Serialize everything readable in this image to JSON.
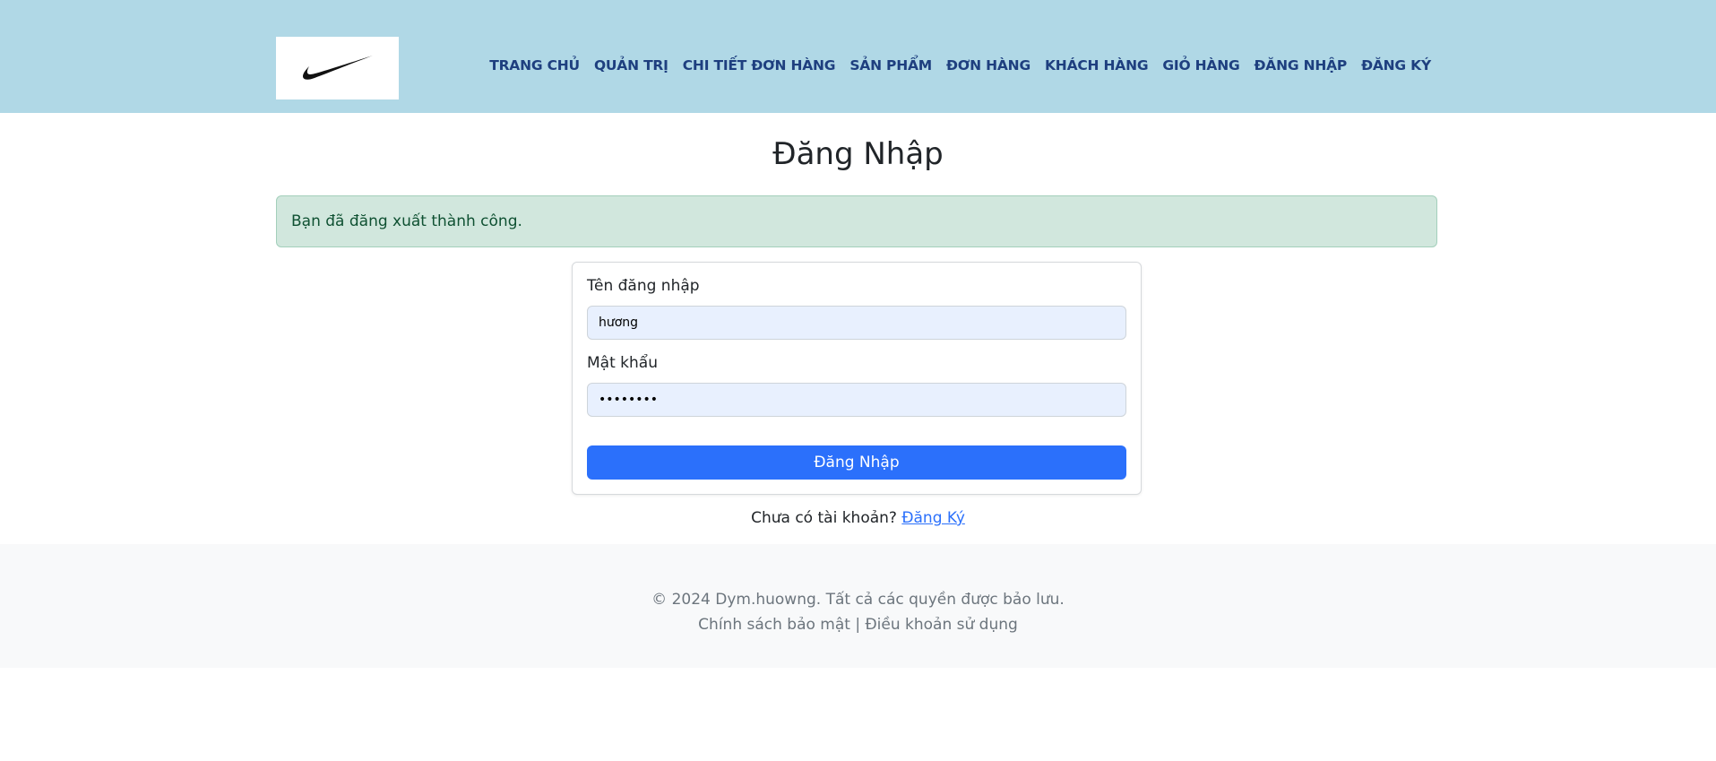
{
  "header": {
    "logo_name": "nike-swoosh-logo",
    "nav": [
      "TRANG CHỦ",
      "QUẢN TRỊ",
      "CHI TIẾT ĐƠN HÀNG",
      "SẢN PHẨM",
      "ĐƠN HÀNG",
      "KHÁCH HÀNG",
      "GIỎ HÀNG",
      "ĐĂNG NHẬP",
      "ĐĂNG KÝ"
    ]
  },
  "main": {
    "title": "Đăng Nhập",
    "alert": "Bạn đã đăng xuất thành công.",
    "form": {
      "username_label": "Tên đăng nhập",
      "username_value": "hương",
      "password_label": "Mật khẩu",
      "password_value": "hươngabc",
      "submit_label": "Đăng Nhập"
    },
    "register_prompt": "Chưa có tài khoản?",
    "register_link": "Đăng Ký"
  },
  "footer": {
    "copyright": "© 2024 Dym.huowng. Tất cả các quyền được bảo lưu.",
    "links": "Chính sách bảo mật | Điều khoản sử dụng"
  },
  "colors": {
    "header_bg": "#b0d8e6",
    "nav_text": "#1e3f7f",
    "primary": "#2b70fb",
    "alert_bg": "#d1e7dd",
    "alert_text": "#0f5132"
  }
}
